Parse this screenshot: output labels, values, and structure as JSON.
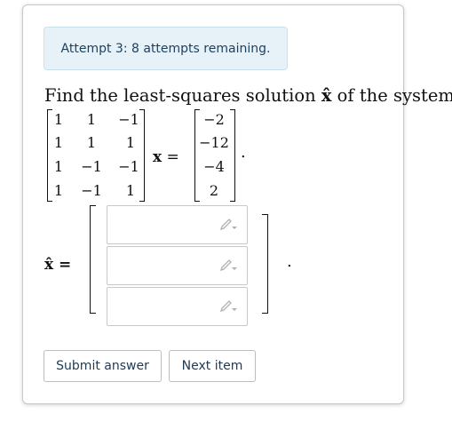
{
  "attempt": {
    "text": "Attempt 3: 8 attempts remaining."
  },
  "question": {
    "prefix": "Find the least-squares solution ",
    "xhat": "x̂",
    "suffix": " of the system"
  },
  "system": {
    "matrix": [
      [
        "1",
        "1",
        "−1"
      ],
      [
        "1",
        "1",
        "1"
      ],
      [
        "1",
        "−1",
        "−1"
      ],
      [
        "1",
        "−1",
        "1"
      ]
    ],
    "x_symbol": "x",
    "equals": " =",
    "rhs": [
      "−2",
      "−12",
      "−4",
      "2"
    ],
    "period": "."
  },
  "answer": {
    "label": "x̂ =",
    "inputs": [
      {
        "value": "",
        "placeholder": ""
      },
      {
        "value": "",
        "placeholder": ""
      },
      {
        "value": "",
        "placeholder": ""
      }
    ],
    "period": "."
  },
  "buttons": {
    "submit": "Submit answer",
    "next": "Next item"
  },
  "colors": {
    "attempt_bg": "#e6f2f8",
    "attempt_text": "#1d3f5e",
    "button_text": "#1e3a55"
  }
}
